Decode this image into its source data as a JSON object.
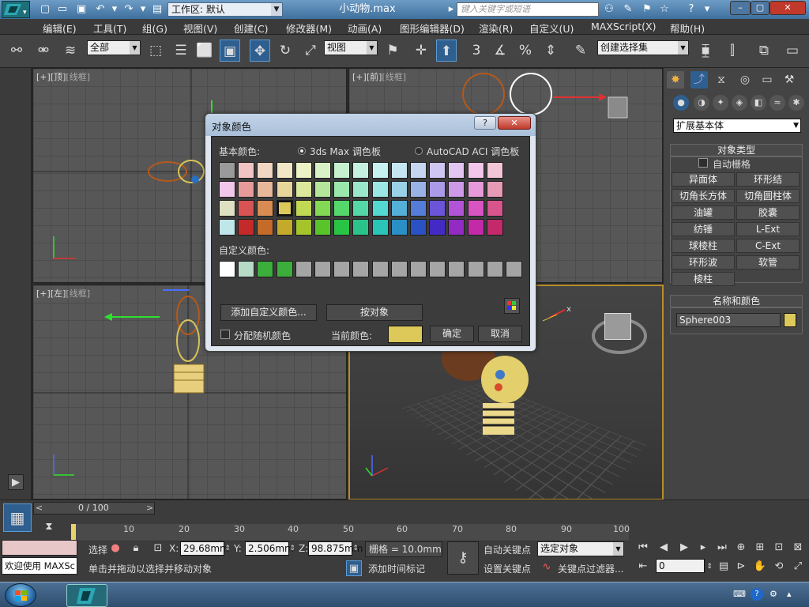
{
  "titlebar": {
    "workspace_label": "工作区: 默认",
    "doc_title": "小动物.max",
    "search_placeholder": "键入关键字或短语"
  },
  "menu": [
    "编辑(E)",
    "工具(T)",
    "组(G)",
    "视图(V)",
    "创建(C)",
    "修改器(M)",
    "动画(A)",
    "图形编辑器(D)",
    "渲染(R)",
    "自定义(U)",
    "MAXScript(X)",
    "帮助(H)"
  ],
  "toolbar": {
    "filter_select": "全部",
    "ref_coord_select": "视图",
    "named_selection": "创建选择集",
    "snap_3": "3",
    "snap_pct": "%"
  },
  "viewports": {
    "top": {
      "label_a": "[+]",
      "label_b": "[顶]",
      "label_c": "[线框]"
    },
    "front": {
      "label_a": "[+]",
      "label_b": "[前]",
      "label_c": "[线框]"
    },
    "left": {
      "label_a": "[+]",
      "label_b": "[左]",
      "label_c": "[线框]"
    },
    "persp": {
      "axis_x": "x"
    }
  },
  "dialog": {
    "title": "对象颜色",
    "help": "?",
    "close": "✕",
    "basic_colors_label": "基本颜色:",
    "palette_max": "3ds Max 调色板",
    "palette_aci": "AutoCAD ACI 调色板",
    "custom_colors_label": "自定义颜色:",
    "add_custom_button": "添加自定义颜色...",
    "by_object_button": "按对象",
    "random_colors_label": "分配随机颜色",
    "current_color_label": "当前颜色:",
    "current_color": "#dcc95a",
    "ok_button": "确定",
    "cancel_button": "取消",
    "basic_rows": [
      [
        "#9a9a9a",
        "#f0c4c4",
        "#f1d6c3",
        "#f1e6c6",
        "#ecf1c6",
        "#d9f1c6",
        "#c6f1cf",
        "#c6f1e0",
        "#c6f1ef",
        "#c6e6f1",
        "#c6d6f1",
        "#cfc6f1",
        "#e2c6f1",
        "#f1c6ea",
        "#f1c6d7"
      ],
      [
        "#f1c6ea",
        "#e79a9a",
        "#e7b79a",
        "#e7d59a",
        "#dbe79a",
        "#b4e79a",
        "#9ae7ab",
        "#9ae7cc",
        "#9ae7e4",
        "#9ad1e7",
        "#9ab3e7",
        "#ab9ae7",
        "#ce9ae7",
        "#e79ad9",
        "#e79ab6"
      ],
      [
        "#dfe2c2",
        "#d85454",
        "#d88c54",
        "#dcc95a",
        "#c1d854",
        "#83d854",
        "#54d86c",
        "#54d8a8",
        "#54d8d2",
        "#54b0d8",
        "#547cd8",
        "#6c54d8",
        "#b154d8",
        "#d854c2",
        "#d8548c"
      ],
      [
        "#bfe6e8",
        "#c42a2a",
        "#c46b2a",
        "#c4aa2a",
        "#a4c42a",
        "#59c42a",
        "#2ac444",
        "#2ac48a",
        "#2ac4b8",
        "#2a8fc4",
        "#2a52c4",
        "#442ac4",
        "#942ac4",
        "#c42aa8",
        "#c42a6b"
      ]
    ],
    "custom_row": [
      "#ffffff",
      "#b6dcc8",
      "#3cae3c",
      "#3cae3c",
      "#a5a5a5",
      "#a5a5a5",
      "#a5a5a5",
      "#a5a5a5",
      "#a5a5a5",
      "#a5a5a5",
      "#a5a5a5",
      "#a5a5a5",
      "#a5a5a5",
      "#a5a5a5",
      "#a5a5a5",
      "#a5a5a5"
    ]
  },
  "command_panel": {
    "category_select": "扩展基本体",
    "object_type_header": "对象类型",
    "auto_grid_label": "自动栅格",
    "buttons": [
      "异面体",
      "环形结",
      "切角长方体",
      "切角圆柱体",
      "油罐",
      "胶囊",
      "纺锤",
      "L-Ext",
      "球棱柱",
      "C-Ext",
      "环形波",
      "软管",
      "棱柱"
    ],
    "name_color_header": "名称和颜色",
    "object_name": "Sphere003",
    "object_color": "#dcc95a"
  },
  "timeline": {
    "frame_display": "0 / 100",
    "ticks": [
      "10",
      "20",
      "30",
      "40",
      "50",
      "60",
      "70",
      "80",
      "90",
      "100"
    ]
  },
  "status": {
    "welcome_text": "欢迎使用 MAXSc",
    "prompt_text": "单击并拖动以选择并移动对象",
    "select_label": "选择",
    "x_label": "X:",
    "x_value": "29.68mm",
    "y_label": "Y:",
    "y_value": "2.506mm",
    "z_label": "Z:",
    "z_value": "98.875mm",
    "grid_text": "栅格 = 10.0mm",
    "add_time_tag": "添加时间标记",
    "auto_key": "自动关键点",
    "set_key": "设置关键点",
    "key_select": "选定对象",
    "key_filters": "关键点过滤器...",
    "frame_field": "0"
  }
}
